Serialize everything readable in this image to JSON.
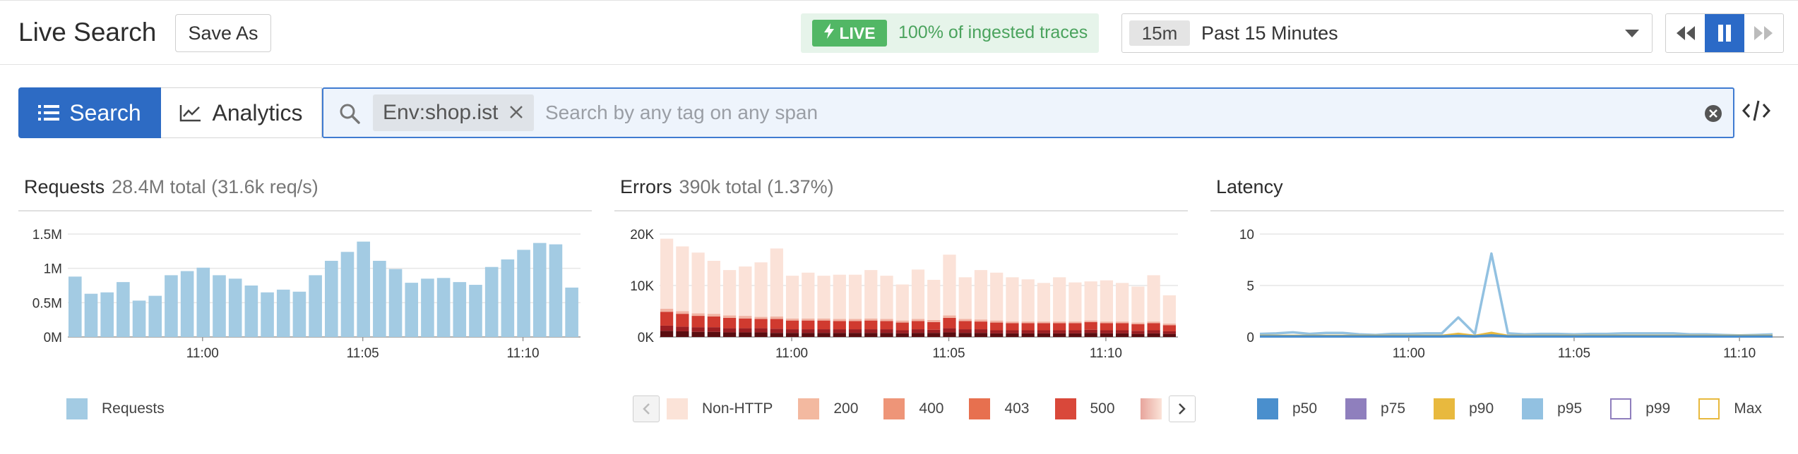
{
  "header": {
    "title": "Live Search",
    "save_as": "Save As",
    "live_badge": "LIVE",
    "ingested": "100% of ingested traces",
    "time_short": "15m",
    "time_long": "Past 15 Minutes"
  },
  "search": {
    "tab_search": "Search",
    "tab_analytics": "Analytics",
    "tag": "Env:shop.ist",
    "placeholder": "Search by any tag on any span"
  },
  "colors": {
    "accent": "#2d6bc4",
    "live_green": "#52b765",
    "requests_bar": "#a3cbe3"
  },
  "icons": [
    "bolt-icon",
    "list-icon",
    "line-chart-icon",
    "search-icon",
    "close-icon",
    "clear-icon",
    "code-icon",
    "rewind-icon",
    "pause-icon",
    "fast-forward-icon",
    "chevron-left-icon",
    "chevron-right-icon",
    "chevron-down-icon"
  ],
  "panels": {
    "requests": {
      "title": "Requests",
      "subtitle": "28.4M total (31.6k req/s)"
    },
    "errors": {
      "title": "Errors",
      "subtitle": "390k total (1.37%)"
    },
    "latency": {
      "title": "Latency"
    }
  },
  "chart_data": [
    {
      "type": "bar",
      "name": "requests",
      "x_ticks": [
        "11:00",
        "11:05",
        "11:10"
      ],
      "x_tick_index": [
        8,
        18,
        28
      ],
      "y_ticks": [
        "0M",
        "0.5M",
        "1M",
        "1.5M"
      ],
      "ylim": [
        0,
        1.5
      ],
      "legend": [
        {
          "name": "Requests",
          "color": "#a3cbe3"
        }
      ],
      "values": [
        0.88,
        0.63,
        0.65,
        0.8,
        0.53,
        0.6,
        0.9,
        0.96,
        1.01,
        0.9,
        0.85,
        0.75,
        0.65,
        0.69,
        0.66,
        0.9,
        1.11,
        1.24,
        1.39,
        1.11,
        0.99,
        0.79,
        0.85,
        0.86,
        0.8,
        0.76,
        1.02,
        1.13,
        1.27,
        1.37,
        1.35,
        0.72
      ]
    },
    {
      "type": "bar",
      "name": "errors",
      "stacked": true,
      "x_ticks": [
        "11:00",
        "11:05",
        "11:10"
      ],
      "x_tick_index": [
        8,
        18,
        28
      ],
      "y_ticks": [
        "0K",
        "10K",
        "20K"
      ],
      "ylim": [
        0,
        20
      ],
      "legend": [
        {
          "name": "Non-HTTP",
          "color": "#fbe3d8"
        },
        {
          "name": "200",
          "color": "#f3b9a0"
        },
        {
          "name": "400",
          "color": "#ee9578"
        },
        {
          "name": "403",
          "color": "#e7704f"
        },
        {
          "name": "500",
          "color": "#d9483a"
        }
      ],
      "legend_truncated_swatch": "#e7a59c",
      "series_colors": [
        "#5a0d10",
        "#9b1e22",
        "#d03a2f",
        "#f1b3a3",
        "#fbe2d8"
      ],
      "stacks": [
        [
          1.2,
          1.0,
          2.7,
          0.6,
          13.6
        ],
        [
          1.1,
          0.9,
          2.5,
          0.5,
          12.6
        ],
        [
          1.0,
          0.9,
          2.2,
          0.5,
          11.8
        ],
        [
          1.0,
          0.9,
          2.1,
          0.5,
          10.3
        ],
        [
          0.9,
          0.8,
          2.0,
          0.5,
          8.8
        ],
        [
          0.9,
          0.8,
          1.9,
          0.5,
          9.6
        ],
        [
          0.9,
          0.8,
          1.8,
          0.4,
          10.6
        ],
        [
          0.8,
          0.8,
          1.9,
          0.5,
          13.2
        ],
        [
          0.8,
          0.7,
          1.7,
          0.4,
          8.3
        ],
        [
          0.8,
          0.7,
          1.7,
          0.4,
          8.9
        ],
        [
          0.8,
          0.7,
          1.7,
          0.4,
          8.3
        ],
        [
          0.8,
          0.7,
          1.6,
          0.4,
          8.6
        ],
        [
          0.8,
          0.7,
          1.6,
          0.4,
          8.6
        ],
        [
          0.8,
          0.7,
          1.7,
          0.4,
          9.4
        ],
        [
          0.8,
          0.7,
          1.6,
          0.4,
          8.4
        ],
        [
          0.7,
          0.6,
          1.5,
          0.4,
          7.0
        ],
        [
          0.8,
          0.7,
          1.6,
          0.4,
          9.6
        ],
        [
          0.8,
          0.6,
          1.5,
          0.4,
          7.8
        ],
        [
          0.9,
          0.8,
          2.0,
          0.5,
          11.8
        ],
        [
          0.8,
          0.7,
          1.6,
          0.4,
          8.1
        ],
        [
          0.8,
          0.7,
          1.5,
          0.4,
          9.6
        ],
        [
          0.7,
          0.6,
          1.5,
          0.4,
          9.3
        ],
        [
          0.7,
          0.6,
          1.4,
          0.3,
          8.6
        ],
        [
          0.7,
          0.6,
          1.4,
          0.3,
          8.2
        ],
        [
          0.7,
          0.6,
          1.4,
          0.3,
          7.5
        ],
        [
          0.7,
          0.6,
          1.4,
          0.3,
          8.6
        ],
        [
          0.7,
          0.6,
          1.4,
          0.3,
          7.6
        ],
        [
          0.8,
          0.6,
          1.5,
          0.3,
          7.6
        ],
        [
          0.7,
          0.6,
          1.4,
          0.3,
          8.0
        ],
        [
          0.7,
          0.6,
          1.4,
          0.3,
          7.5
        ],
        [
          0.6,
          0.6,
          1.3,
          0.3,
          7.0
        ],
        [
          0.7,
          0.6,
          1.4,
          0.3,
          9.0
        ],
        [
          0.6,
          0.5,
          1.2,
          0.3,
          5.5
        ]
      ]
    },
    {
      "type": "line",
      "name": "latency",
      "x_ticks": [
        "11:00",
        "11:05",
        "11:10"
      ],
      "x_tick_index": [
        9,
        19,
        29
      ],
      "y_ticks": [
        "0",
        "5",
        "10"
      ],
      "ylim": [
        0,
        10
      ],
      "legend": [
        {
          "name": "p50",
          "color": "#4a8fcd",
          "filled": true
        },
        {
          "name": "p75",
          "color": "#8f7fbd",
          "filled": true
        },
        {
          "name": "p90",
          "color": "#e8b93e",
          "filled": true
        },
        {
          "name": "p95",
          "color": "#92c1e1",
          "filled": true
        },
        {
          "name": "p99",
          "color": "#8f7fbd",
          "filled": false
        },
        {
          "name": "Max",
          "color": "#e8b93e",
          "filled": false
        }
      ],
      "series": [
        {
          "name": "p95",
          "color": "#92c1e1",
          "values": [
            0.3,
            0.35,
            0.45,
            0.3,
            0.4,
            0.4,
            0.25,
            0.2,
            0.3,
            0.3,
            0.35,
            0.35,
            1.9,
            0.3,
            8.1,
            0.35,
            0.25,
            0.3,
            0.3,
            0.25,
            0.3,
            0.3,
            0.35,
            0.35,
            0.35,
            0.35,
            0.25,
            0.25,
            0.2,
            0.15,
            0.2,
            0.25
          ]
        },
        {
          "name": "p90",
          "color": "#e8b93e",
          "values": [
            0.1,
            0.1,
            0.1,
            0.1,
            0.1,
            0.1,
            0.1,
            0.1,
            0.1,
            0.1,
            0.1,
            0.1,
            0.3,
            0.1,
            0.4,
            0.1,
            0.1,
            0.1,
            0.1,
            0.1,
            0.1,
            0.1,
            0.1,
            0.1,
            0.1,
            0.1,
            0.1,
            0.1,
            0.1,
            0.1,
            0.1,
            0.1
          ]
        },
        {
          "name": "p50",
          "color": "#4a8fcd",
          "values": [
            0.05,
            0.05,
            0.05,
            0.05,
            0.05,
            0.05,
            0.05,
            0.05,
            0.05,
            0.05,
            0.05,
            0.05,
            0.1,
            0.05,
            0.15,
            0.05,
            0.05,
            0.05,
            0.05,
            0.05,
            0.05,
            0.05,
            0.05,
            0.05,
            0.05,
            0.05,
            0.05,
            0.05,
            0.05,
            0.05,
            0.05,
            0.05
          ]
        }
      ]
    }
  ]
}
